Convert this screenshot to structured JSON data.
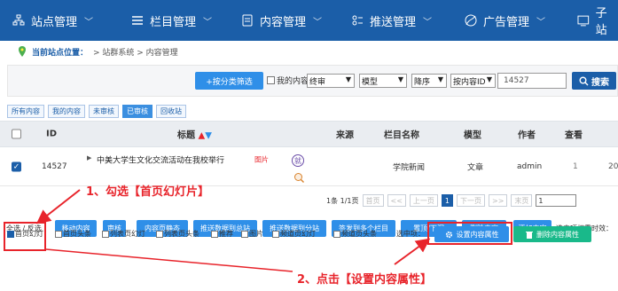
{
  "topnav": {
    "items": [
      {
        "icon": "sitemap-icon",
        "label": "站点管理"
      },
      {
        "icon": "list-icon",
        "label": "栏目管理"
      },
      {
        "icon": "document-icon",
        "label": "内容管理"
      },
      {
        "icon": "push-icon",
        "label": "推送管理"
      },
      {
        "icon": "ad-icon",
        "label": "广告管理"
      },
      {
        "icon": "subsite-icon",
        "label": "子站"
      }
    ]
  },
  "breadcrumb": {
    "location_label": "当前站点位置：",
    "path": "> 站群系统 > 内容管理"
  },
  "filterbar": {
    "filter_button": "+按分类筛选",
    "my_content_label": "我的内容",
    "audit_select": "终审",
    "model_select": "模型",
    "order_select": "降序",
    "sort_by_select": "按内容ID",
    "search_value": "14527",
    "search_button": "搜索"
  },
  "tabs": [
    "所有内容",
    "我的内容",
    "未审核",
    "已审核",
    "回收站"
  ],
  "table": {
    "headers": {
      "id": "ID",
      "title": "标题",
      "source": "来源",
      "column": "栏目名称",
      "model": "模型",
      "author": "作者",
      "view": "查看"
    },
    "rows": [
      {
        "checked": true,
        "id": "14527",
        "title": "中美大学生文化交流活动在我校举行",
        "flag": "图片",
        "badge": "就",
        "column": "学院新闻",
        "model": "文章",
        "author": "admin",
        "view": "1",
        "date": "20"
      }
    ]
  },
  "pager": {
    "summary": "1条 1/1页",
    "first": "首页",
    "prev_fast": "<<",
    "prev": "上一页",
    "current": "1",
    "next": "下一页",
    "next_fast": ">>",
    "last": "末页",
    "page_input": "1"
  },
  "actions": {
    "select_all": "全选 / 反选",
    "buttons": [
      "移动内容",
      "审核",
      "内容页静态",
      "推送数据到总站",
      "推送数据到分站",
      "签发到多个栏目",
      "置顶/下沉",
      "删除内容",
      "添加内容"
    ],
    "weight_label": "选中项权重时效："
  },
  "flags": {
    "items": [
      {
        "label": "首页幻灯",
        "checked": true
      },
      {
        "label": "首页头条",
        "checked": false
      },
      {
        "label": "列表页幻灯",
        "checked": false
      },
      {
        "label": "列表页头条",
        "checked": false
      },
      {
        "label": "推荐",
        "checked": false
      },
      {
        "label": "图片",
        "checked": false
      },
      {
        "label": "频道页幻灯",
        "checked": false
      },
      {
        "label": "频道页头条",
        "checked": false
      }
    ],
    "selected_label": "选中项：",
    "set_button": "设置内容属性",
    "delete_button": "删除内容属性"
  },
  "annotations": {
    "step1": "1、勾选【首页幻灯片】",
    "step2": "2、点击【设置内容属性】"
  },
  "colors": {
    "nav_bg": "#1b5ea8",
    "accent": "#2f8fe8",
    "annotation": "#e8242b",
    "green": "#19b98a"
  }
}
